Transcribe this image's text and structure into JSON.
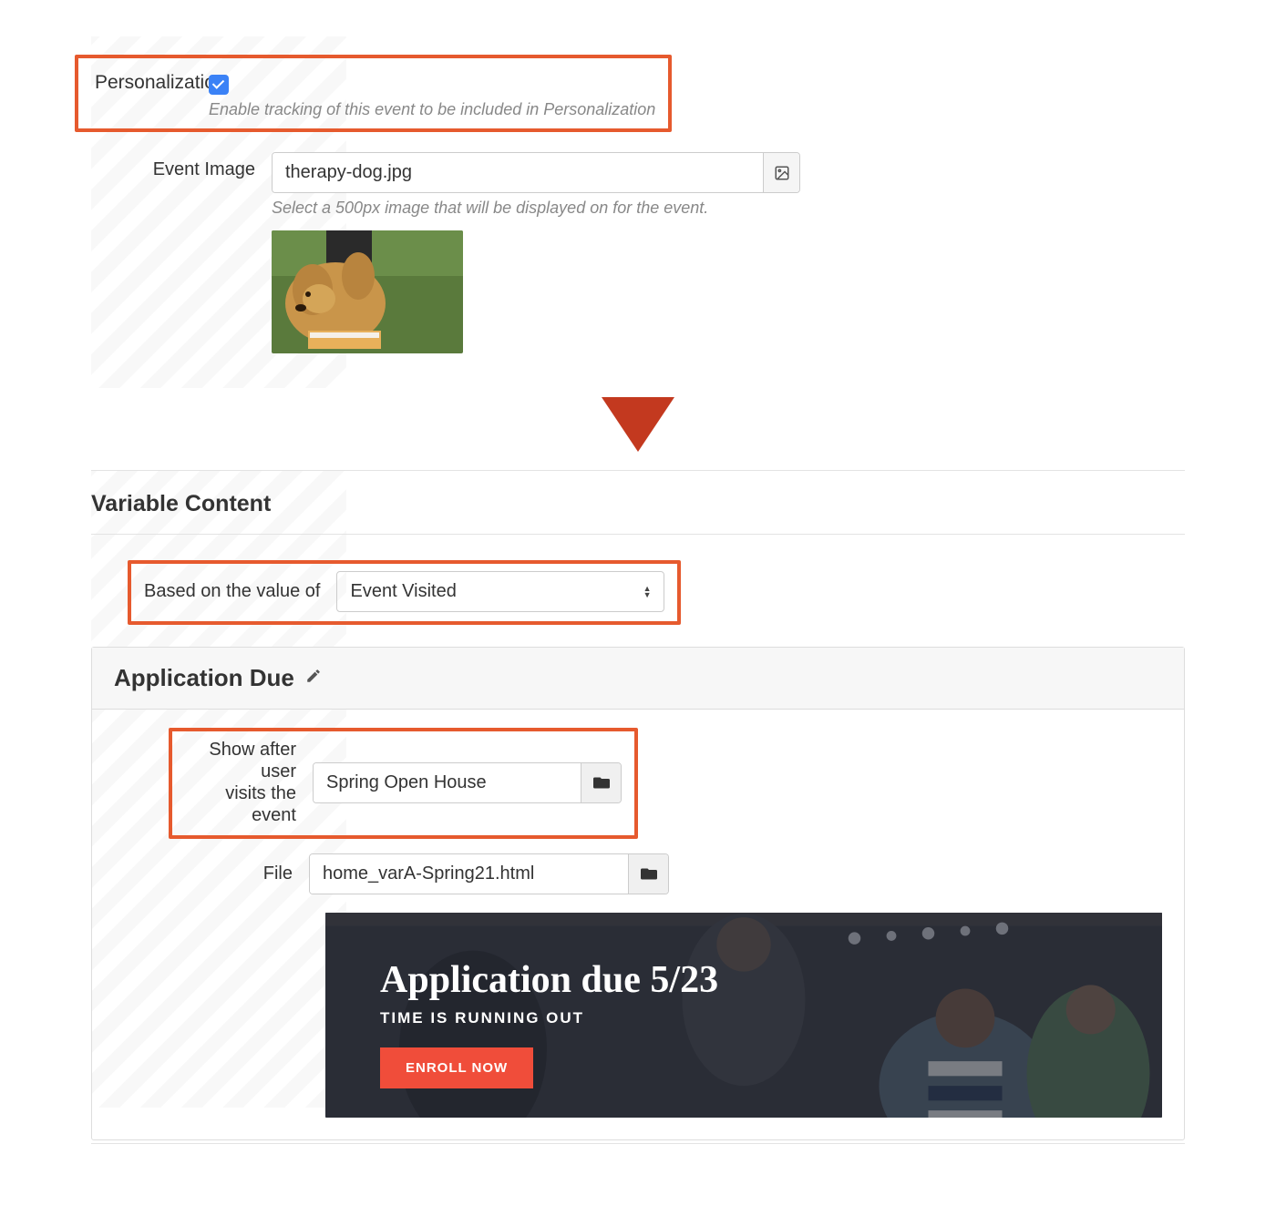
{
  "upper": {
    "personalization_label": "Personalization",
    "personalization_help": "Enable tracking of this event to be included in Personalization",
    "event_image_label": "Event Image",
    "event_image_value": "therapy-dog.jpg",
    "event_image_help": "Select a 500px image that will be displayed on for the event."
  },
  "section": {
    "title": "Variable Content",
    "based_label": "Based on the value of",
    "based_value": "Event Visited"
  },
  "panel": {
    "title": "Application Due",
    "show_after_label_l1": "Show after user",
    "show_after_label_l2": "visits the event",
    "show_after_value": "Spring Open House",
    "file_label": "File",
    "file_value": "home_varA-Spring21.html"
  },
  "banner": {
    "title": "Application due 5/23",
    "subtitle": "TIME IS RUNNING OUT",
    "button": "ENROLL NOW"
  }
}
